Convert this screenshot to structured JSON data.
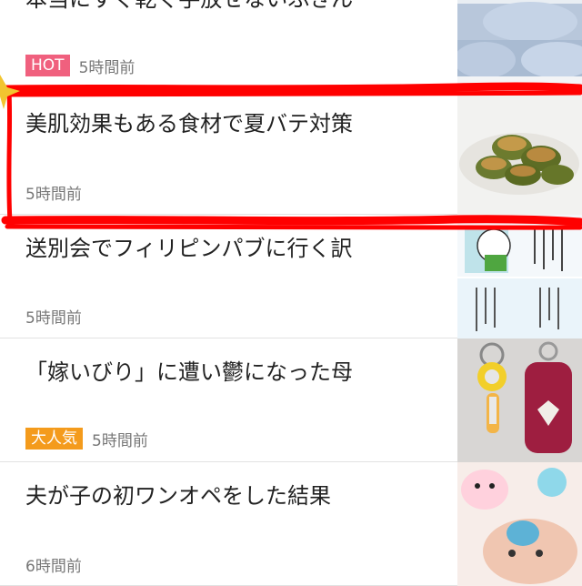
{
  "feed": {
    "items": [
      {
        "title": "本当にすぐ乾く手放せないふきん",
        "badge": "HOT",
        "badge_color": "#f0607e",
        "time": "5時間前",
        "thumb": "towels"
      },
      {
        "title": "美肌効果もある食材で夏バテ対策",
        "badge": "",
        "time": "5時間前",
        "thumb": "zucchini-dish"
      },
      {
        "title": "送別会でフィリピンパブに行く訳",
        "badge": "",
        "time": "5時間前",
        "thumb": "manga-page"
      },
      {
        "title": "「嫁いびり」に遭い鬱になった母",
        "badge": "大人気",
        "badge_color": "#f49b1c",
        "time": "5時間前",
        "thumb": "keychains"
      },
      {
        "title": "夫が子の初ワンオペをした結果",
        "badge": "",
        "time": "6時間前",
        "thumb": "baby-sticker"
      }
    ]
  },
  "annotation": {
    "color": "#ff0000",
    "shape": "hand-drawn rectangle"
  }
}
